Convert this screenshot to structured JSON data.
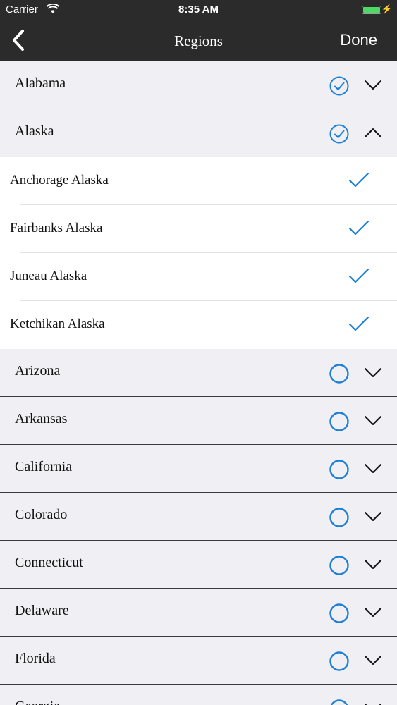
{
  "status_bar": {
    "carrier": "Carrier",
    "time": "8:35 AM",
    "battery_level": 1.0
  },
  "nav": {
    "title": "Regions",
    "done_label": "Done"
  },
  "accent_color": "#1e7fd6",
  "states": [
    {
      "label": "Alabama",
      "selected": true,
      "expanded": false
    },
    {
      "label": "Alaska",
      "selected": true,
      "expanded": true,
      "cities": [
        "Anchorage Alaska",
        "Fairbanks Alaska",
        "Juneau Alaska",
        "Ketchikan Alaska"
      ]
    },
    {
      "label": "Arizona",
      "selected": false,
      "expanded": false
    },
    {
      "label": "Arkansas",
      "selected": false,
      "expanded": false
    },
    {
      "label": "California",
      "selected": false,
      "expanded": false
    },
    {
      "label": "Colorado",
      "selected": false,
      "expanded": false
    },
    {
      "label": "Connecticut",
      "selected": false,
      "expanded": false
    },
    {
      "label": "Delaware",
      "selected": false,
      "expanded": false
    },
    {
      "label": "Florida",
      "selected": false,
      "expanded": false
    },
    {
      "label": "Georgia",
      "selected": false,
      "expanded": false
    }
  ]
}
